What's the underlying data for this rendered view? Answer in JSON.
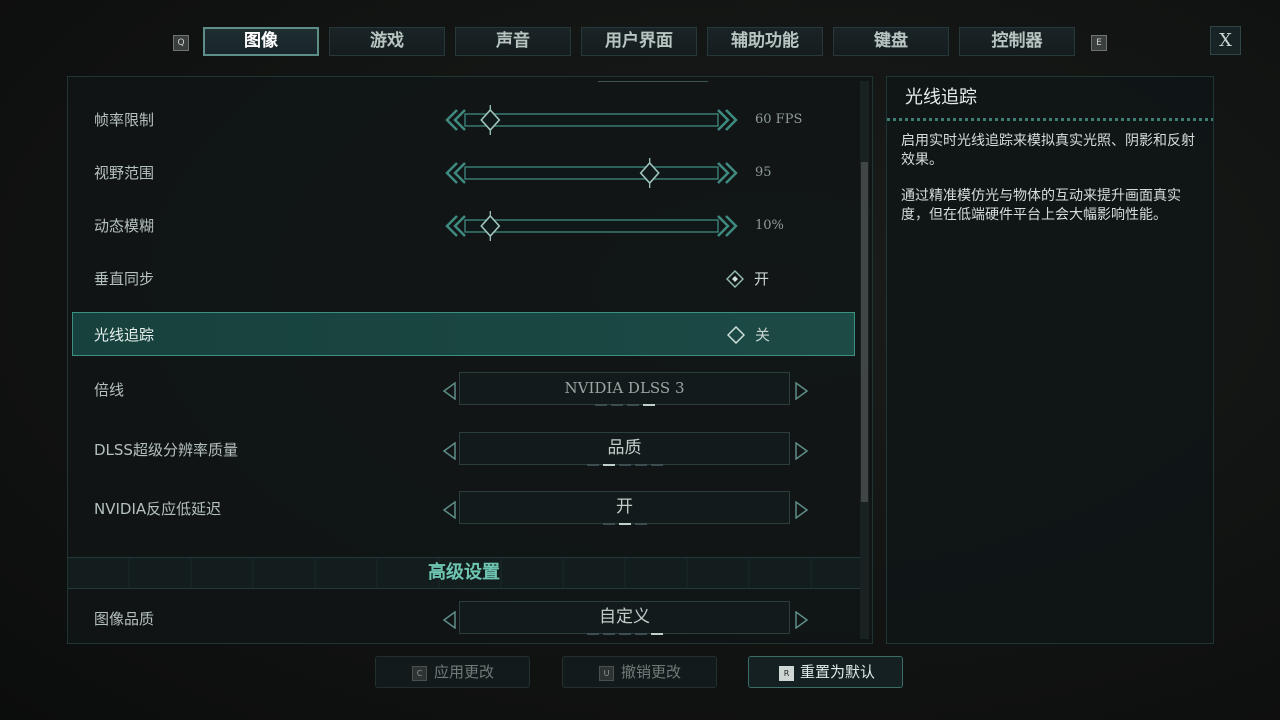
{
  "tabs": {
    "left_key": "Q",
    "right_key": "E",
    "items": [
      "图像",
      "游戏",
      "声音",
      "用户界面",
      "辅助功能",
      "键盘",
      "控制器"
    ],
    "active_index": 0
  },
  "close_label": "X",
  "settings": {
    "frame_limit": {
      "label": "帧率限制",
      "value": "60 FPS",
      "level": 0.1
    },
    "fov": {
      "label": "视野范围",
      "value": "95",
      "level": 0.73
    },
    "motion_blur": {
      "label": "动态模糊",
      "value": "10%",
      "level": 0.1
    },
    "vsync": {
      "label": "垂直同步",
      "value": "开"
    },
    "ray_tracing": {
      "label": "光线追踪",
      "value": "关"
    },
    "upscaling": {
      "label": "倍线",
      "value": "NVIDIA DLSS 3",
      "option_count": 4,
      "option_index": 3
    },
    "dlss_quality": {
      "label": "DLSS超级分辨率质量",
      "value": "品质",
      "option_count": 5,
      "option_index": 1
    },
    "reflex": {
      "label": "NVIDIA反应低延迟",
      "value": "开",
      "option_count": 3,
      "option_index": 1
    },
    "advanced_title": "高级设置",
    "image_quality": {
      "label": "图像品质",
      "value": "自定义",
      "option_count": 5,
      "option_index": 4
    }
  },
  "info": {
    "title": "光线追踪",
    "p1": "启用实时光线追踪来模拟真实光照、阴影和反射效果。",
    "p2": "通过精准模仿光与物体的互动来提升画面真实度，但在低端硬件平台上会大幅影响性能。"
  },
  "buttons": {
    "apply": {
      "key": "C",
      "label": "应用更改"
    },
    "revert": {
      "key": "U",
      "label": "撤销更改"
    },
    "reset": {
      "key": "R",
      "label": "重置为默认"
    }
  },
  "colors": {
    "accent": "#3d8f80",
    "selected_row": "#17413d",
    "section_title": "#6ec6b2"
  }
}
